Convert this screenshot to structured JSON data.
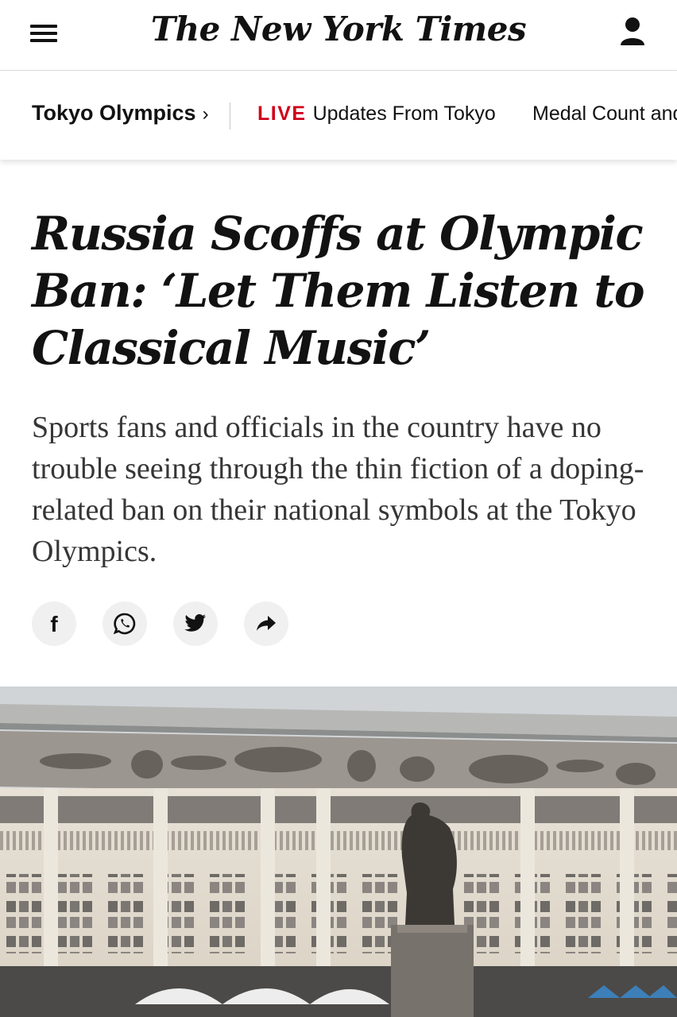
{
  "masthead": {
    "logo": "The New York Times",
    "menu_icon": "hamburger-menu-icon",
    "account_icon": "user-account-icon"
  },
  "nav": {
    "section_label": "Tokyo Olympics",
    "section_chevron": "›",
    "live_tag": "LIVE",
    "live_link": "Updates From Tokyo",
    "medal_link": "Medal Count and"
  },
  "article": {
    "headline": "Russia Scoffs at Olympic Ban: ‘Let Them Listen to Classical Music’",
    "summary": "Sports fans and officials in the country have no trouble seeing through the thin fiction of a doping-related ban on their national symbols at the Tokyo Olympics."
  },
  "share": {
    "icons": [
      "facebook-icon",
      "whatsapp-icon",
      "twitter-icon",
      "share-arrow-icon"
    ]
  },
  "colors": {
    "live_red": "#d0021b",
    "text": "#121212",
    "share_bg": "#f0f0f0"
  }
}
